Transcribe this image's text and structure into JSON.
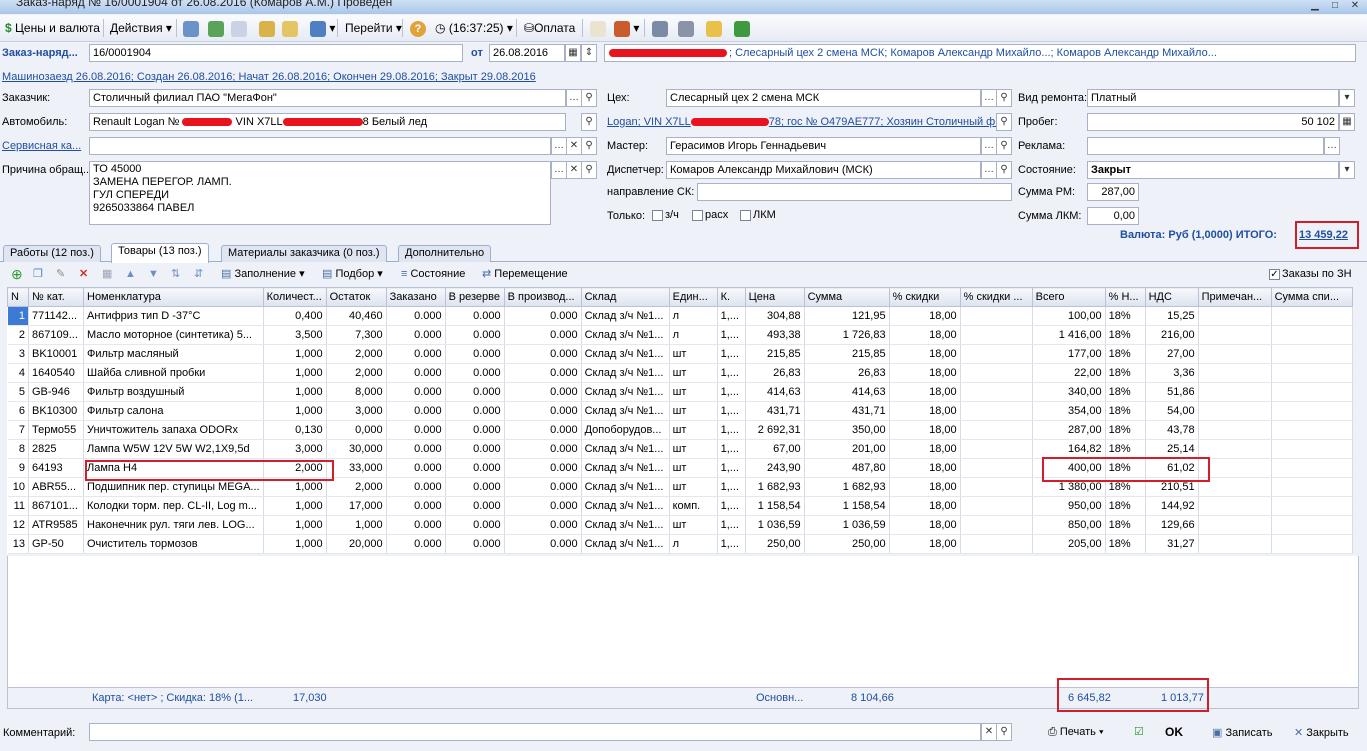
{
  "window": {
    "title": "Заказ-наряд № 16/0001904 от 26.08.2016 (Комаров А.М.) Проведен"
  },
  "toolbar": {
    "prices": "Цены и валюта",
    "actions": "Действия",
    "goto": "Перейти",
    "time": "(16:37:25)",
    "pay": "Оплата"
  },
  "header": {
    "doc_label": "Заказ-наряд...",
    "doc_number": "16/0001904",
    "from_label": "от",
    "date": "26.08.2016",
    "org_text": "; Слесарный цех 2 смена МСК; Комаров Александр Михайло...; Комаров Александр Михайло...",
    "history": "Машинозаезд 26.08.2016; Создан 26.08.2016; Начат 26.08.2016; Окончен 29.08.2016; Закрыт 29.08.2016"
  },
  "form": {
    "customer_label": "Заказчик:",
    "customer": "Столичный филиал ПАО \"МегаФон\"",
    "car_label": "Автомобиль:",
    "car_a": "Renault Logan №",
    "car_b": "VIN X7LL",
    "car_c": "8 Белый лед",
    "service_label": "Сервисная ка...",
    "reason_label": "Причина обращ...",
    "reason_lines": [
      "ТО 45000",
      "ЗАМЕНА ПЕРЕГОР. ЛАМП.",
      "ГУЛ СПЕРЕДИ",
      "9265033864 ПАВЕЛ"
    ],
    "shop_label": "Цех:",
    "shop": "Слесарный цех 2 смена МСК",
    "car_link_a": "Logan; VIN X7LL",
    "car_link_b": "78; гос № О479АЕ777; Хозяин Столичный фил...",
    "master_label": "Мастер:",
    "master": "Герасимов Игорь Геннадьевич",
    "dispatcher_label": "Диспетчер:",
    "dispatcher": "Комаров Александр Михайлович (МСК)",
    "direction_label": "направление СК:",
    "only_label": "Только:",
    "only_options": [
      "з/ч",
      "расх",
      "ЛКМ"
    ],
    "repair_label": "Вид ремонта:",
    "repair": "Платный",
    "mileage_label": "Пробег:",
    "mileage": "50 102",
    "ads_label": "Реклама:",
    "state_label": "Состояние:",
    "state": "Закрыт",
    "sum_rm_label": "Сумма РМ:",
    "sum_rm": "287,00",
    "sum_lkm_label": "Сумма ЛКМ:",
    "sum_lkm": "0,00",
    "currency_text": "Валюта: Руб (1,0000) ИТОГО:",
    "total": "13 459,22"
  },
  "tabs": [
    "Работы (12 поз.)",
    "Товары (13 поз.)",
    "Материалы заказчика (0 поз.)",
    "Дополнительно"
  ],
  "grid_toolbar": {
    "fill": "Заполнение",
    "pick": "Подбор",
    "state": "Состояние",
    "move": "Перемещение",
    "orders_zn": "Заказы по ЗН"
  },
  "columns": [
    "N",
    "№ кат.",
    "Номенклатура",
    "Количест...",
    "Остаток",
    "Заказано",
    "В резерве",
    "В производ...",
    "Склад",
    "Един...",
    "К.",
    "Цена",
    "Сумма",
    "% скидки",
    "% скидки ...",
    "Всего",
    "% Н...",
    "НДС",
    "Примечан...",
    "Сумма спи..."
  ],
  "rows": [
    [
      "1",
      "771142...",
      "Антифриз тип D -37°C",
      "0,400",
      "40,460",
      "0.000",
      "0.000",
      "0.000",
      "Склад з/ч №1...",
      "л",
      "1,...",
      "304,88",
      "121,95",
      "18,00",
      "",
      "100,00",
      "18%",
      "15,25",
      "",
      ""
    ],
    [
      "2",
      "867109...",
      "Масло моторное (синтетика) 5...",
      "3,500",
      "7,300",
      "0.000",
      "0.000",
      "0.000",
      "Склад з/ч №1...",
      "л",
      "1,...",
      "493,38",
      "1 726,83",
      "18,00",
      "",
      "1 416,00",
      "18%",
      "216,00",
      "",
      ""
    ],
    [
      "3",
      "BK10001",
      "Фильтр масляный",
      "1,000",
      "2,000",
      "0.000",
      "0.000",
      "0.000",
      "Склад з/ч №1...",
      "шт",
      "1,...",
      "215,85",
      "215,85",
      "18,00",
      "",
      "177,00",
      "18%",
      "27,00",
      "",
      ""
    ],
    [
      "4",
      "1640540",
      "Шайба сливной пробки",
      "1,000",
      "2,000",
      "0.000",
      "0.000",
      "0.000",
      "Склад з/ч №1...",
      "шт",
      "1,...",
      "26,83",
      "26,83",
      "18,00",
      "",
      "22,00",
      "18%",
      "3,36",
      "",
      ""
    ],
    [
      "5",
      "GB-946",
      "Фильтр воздушный",
      "1,000",
      "8,000",
      "0.000",
      "0.000",
      "0.000",
      "Склад з/ч №1...",
      "шт",
      "1,...",
      "414,63",
      "414,63",
      "18,00",
      "",
      "340,00",
      "18%",
      "51,86",
      "",
      ""
    ],
    [
      "6",
      "BK10300",
      "Фильтр салона",
      "1,000",
      "3,000",
      "0.000",
      "0.000",
      "0.000",
      "Склад з/ч №1...",
      "шт",
      "1,...",
      "431,71",
      "431,71",
      "18,00",
      "",
      "354,00",
      "18%",
      "54,00",
      "",
      ""
    ],
    [
      "7",
      "Термо55",
      "Уничтожитель запаха ODORx",
      "0,130",
      "0,000",
      "0.000",
      "0.000",
      "0.000",
      "Допоборудов...",
      "шт",
      "1,...",
      "2 692,31",
      "350,00",
      "18,00",
      "",
      "287,00",
      "18%",
      "43,78",
      "",
      ""
    ],
    [
      "8",
      "2825",
      "Лампа W5W 12V 5W W2,1X9,5d",
      "3,000",
      "30,000",
      "0.000",
      "0.000",
      "0.000",
      "Склад з/ч №1...",
      "шт",
      "1,...",
      "67,00",
      "201,00",
      "18,00",
      "",
      "164,82",
      "18%",
      "25,14",
      "",
      ""
    ],
    [
      "9",
      "64193",
      "Лампа H4",
      "2,000",
      "33,000",
      "0.000",
      "0.000",
      "0.000",
      "Склад з/ч №1...",
      "шт",
      "1,...",
      "243,90",
      "487,80",
      "18,00",
      "",
      "400,00",
      "18%",
      "61,02",
      "",
      ""
    ],
    [
      "10",
      "ABR55...",
      "Подшипник пер. ступицы MEGA...",
      "1,000",
      "2,000",
      "0.000",
      "0.000",
      "0.000",
      "Склад з/ч №1...",
      "шт",
      "1,...",
      "1 682,93",
      "1 682,93",
      "18,00",
      "",
      "1 380,00",
      "18%",
      "210,51",
      "",
      ""
    ],
    [
      "11",
      "867101...",
      "Колодки торм. пер. CL-II, Log m...",
      "1,000",
      "17,000",
      "0.000",
      "0.000",
      "0.000",
      "Склад з/ч №1...",
      "комп.",
      "1,...",
      "1 158,54",
      "1 158,54",
      "18,00",
      "",
      "950,00",
      "18%",
      "144,92",
      "",
      ""
    ],
    [
      "12",
      "ATR9585",
      "Наконечник рул. тяги лев. LOG...",
      "1,000",
      "1,000",
      "0.000",
      "0.000",
      "0.000",
      "Склад з/ч №1...",
      "шт",
      "1,...",
      "1 036,59",
      "1 036,59",
      "18,00",
      "",
      "850,00",
      "18%",
      "129,66",
      "",
      ""
    ],
    [
      "13",
      "GP-50",
      "Очиститель тормозов",
      "1,000",
      "20,000",
      "0.000",
      "0.000",
      "0.000",
      "Склад з/ч №1...",
      "л",
      "1,...",
      "250,00",
      "250,00",
      "18,00",
      "",
      "205,00",
      "18%",
      "31,27",
      "",
      ""
    ]
  ],
  "footer": {
    "card": "Карта: <нет> ; Скидка: 18% (1...",
    "qty_total": "17,030",
    "osn": "Основн...",
    "sum_total": "8 104,66",
    "all_total": "6 645,82",
    "vat_total": "1 013,77"
  },
  "bottom": {
    "comment_label": "Комментарий:",
    "print": "Печать",
    "ok": "OK",
    "save": "Записать",
    "close": "Закрыть"
  }
}
